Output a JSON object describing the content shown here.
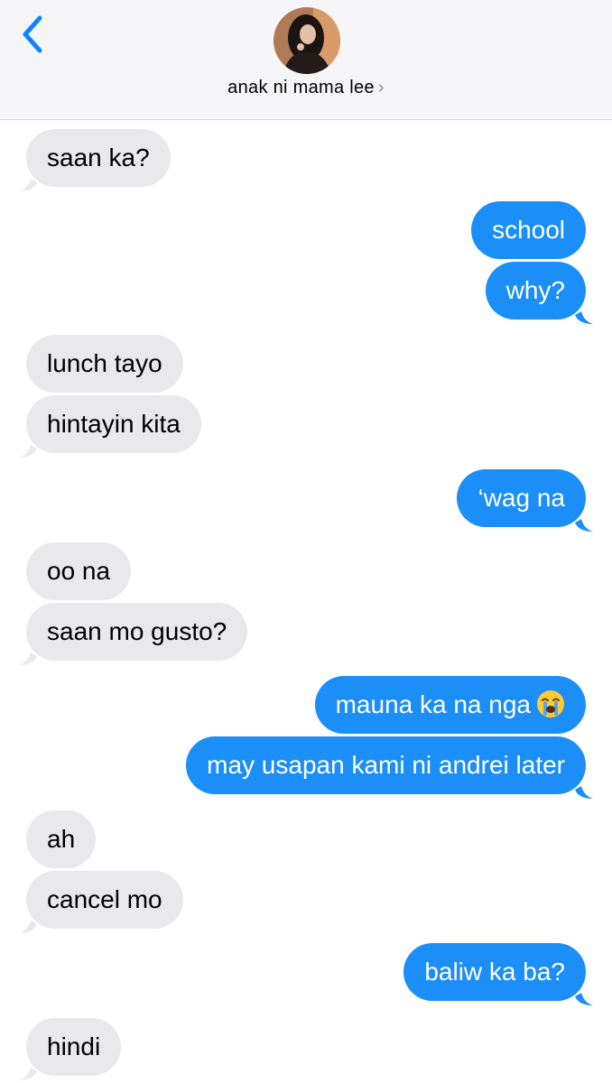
{
  "header": {
    "back_icon": "chevron-left-icon",
    "contact_name": "anak ni mama lee",
    "chevron": "›"
  },
  "colors": {
    "outgoing": "#1b8ef8",
    "incoming": "#e9e9eb",
    "accent": "#0a84ff"
  },
  "messages": [
    {
      "dir": "in",
      "text": "saan ka?"
    },
    {
      "dir": "out",
      "text": "school"
    },
    {
      "dir": "out",
      "text": "why?"
    },
    {
      "dir": "in",
      "text": "lunch tayo"
    },
    {
      "dir": "in",
      "text": "hintayin kita"
    },
    {
      "dir": "out",
      "text": "‘wag na"
    },
    {
      "dir": "in",
      "text": "oo na"
    },
    {
      "dir": "in",
      "text": "saan mo gusto?"
    },
    {
      "dir": "out",
      "text": "mauna ka na nga",
      "emoji": "loudly-crying-face-emoji"
    },
    {
      "dir": "out",
      "text": "may usapan kami ni andrei later"
    },
    {
      "dir": "in",
      "text": "ah"
    },
    {
      "dir": "in",
      "text": "cancel mo"
    },
    {
      "dir": "out",
      "text": "baliw ka ba?"
    },
    {
      "dir": "in",
      "text": "hindi"
    }
  ]
}
